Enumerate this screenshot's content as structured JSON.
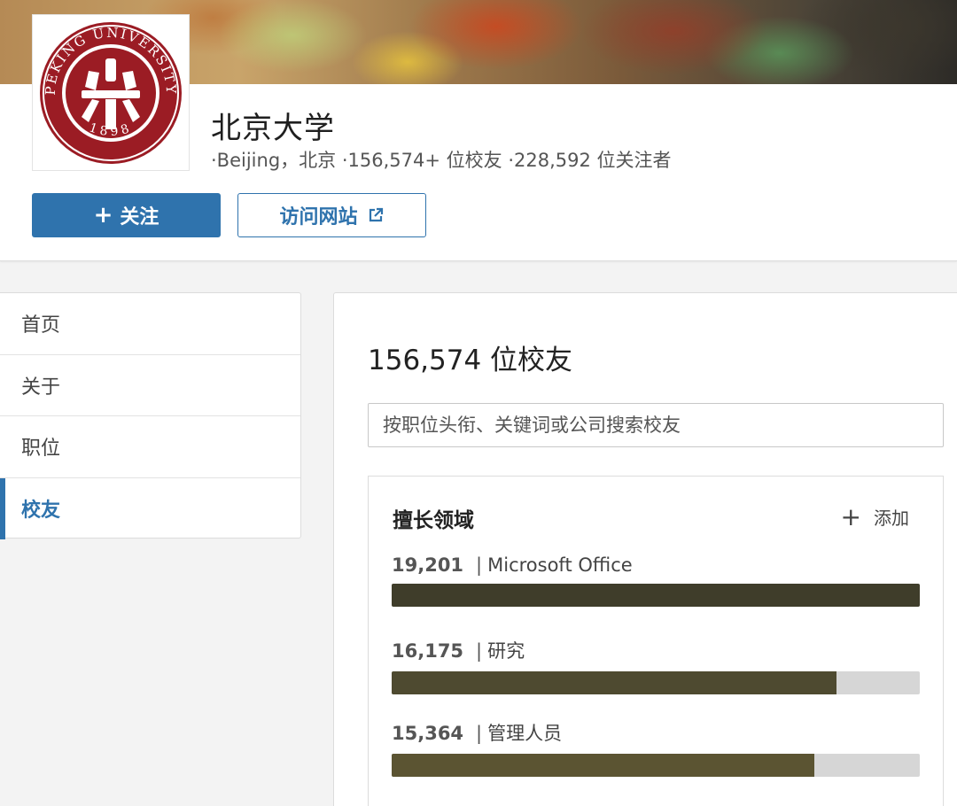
{
  "header": {
    "org_name": "北京大学",
    "logo_text": "PEKING UNIVERSITY",
    "logo_year": "1898",
    "meta_location": "·Beijing，北京",
    "meta_alumni": "·156,574+ 位校友",
    "meta_followers": "·228,592 位关注者",
    "follow_label": "关注",
    "website_label": "访问网站"
  },
  "sidenav": {
    "items": [
      {
        "label": "首页",
        "active": false
      },
      {
        "label": "关于",
        "active": false
      },
      {
        "label": "职位",
        "active": false
      },
      {
        "label": "校友",
        "active": true
      }
    ]
  },
  "main": {
    "alumni_count": "156,574 位校友",
    "search_placeholder": "按职位头衔、关键词或公司搜索校友",
    "skills": {
      "title": "擅长领域",
      "add_label": "添加",
      "items": [
        {
          "count": "19,201",
          "label": "Microsoft Office",
          "fraction": 1.0,
          "color": "#3f3d2a"
        },
        {
          "count": "16,175",
          "label": "研究",
          "fraction": 0.842,
          "color": "#4e4a30"
        },
        {
          "count": "15,364",
          "label": "管理人员",
          "fraction": 0.8,
          "color": "#5b5432"
        }
      ]
    }
  },
  "colors": {
    "accent": "#2f73ad",
    "logo_red": "#9b1c24"
  }
}
